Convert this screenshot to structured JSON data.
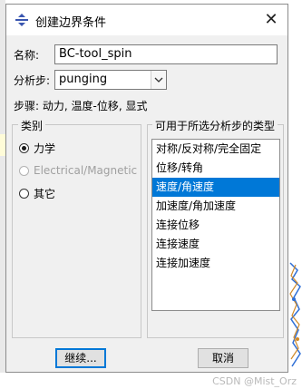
{
  "window": {
    "title": "创建边界条件",
    "close_label": "✕"
  },
  "form": {
    "name_label": "名称:",
    "name_value": "BC-tool_spin",
    "step_label": "分析步:",
    "step_value": "punging",
    "procedure_text": "步骤: 动力, 温度-位移, 显式"
  },
  "category": {
    "title": "类别",
    "options": [
      {
        "label": "力学",
        "checked": true,
        "enabled": true
      },
      {
        "label": "Electrical/Magnetic",
        "checked": false,
        "enabled": false
      },
      {
        "label": "其它",
        "checked": false,
        "enabled": true
      }
    ]
  },
  "types": {
    "title": "可用于所选分析步的类型",
    "items": [
      "对称/反对称/完全固定",
      "位移/转角",
      "速度/角速度",
      "加速度/角加速度",
      "连接位移",
      "连接速度",
      "连接加速度"
    ],
    "selected_index": 2
  },
  "buttons": {
    "continue": "继续...",
    "cancel": "取消"
  },
  "watermark": "CSDN @Mist_Orz",
  "colors": {
    "selection": "#0078d7",
    "dialog_bg": "#f0f0f0",
    "accent": "#3a56b0"
  }
}
